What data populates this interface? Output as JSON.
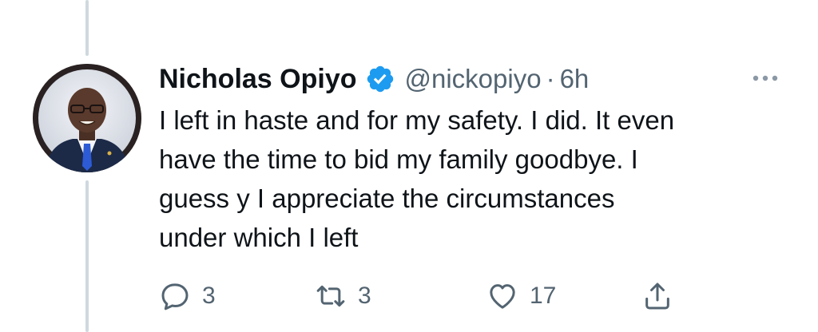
{
  "tweet": {
    "author_name": "Nicholas Opiyo",
    "verified": true,
    "handle": "@nickopiyo",
    "separator": "·",
    "time": "6h",
    "text": "I left in haste and for my safety. I did. It even\nhave the time to bid my family goodbye. I\nguess y I appreciate the circumstances\nunder which I left",
    "avatar_icon": "profile-photo"
  },
  "actions": {
    "reply": {
      "icon": "reply-icon",
      "count": "3"
    },
    "retweet": {
      "icon": "retweet-icon",
      "count": "3"
    },
    "like": {
      "icon": "heart-icon",
      "count": "17"
    },
    "share": {
      "icon": "share-icon"
    }
  },
  "colors": {
    "text": "#0f1419",
    "secondary": "#536471",
    "verified_badge": "#1d9bf0",
    "thread_line": "#cfd9de"
  }
}
